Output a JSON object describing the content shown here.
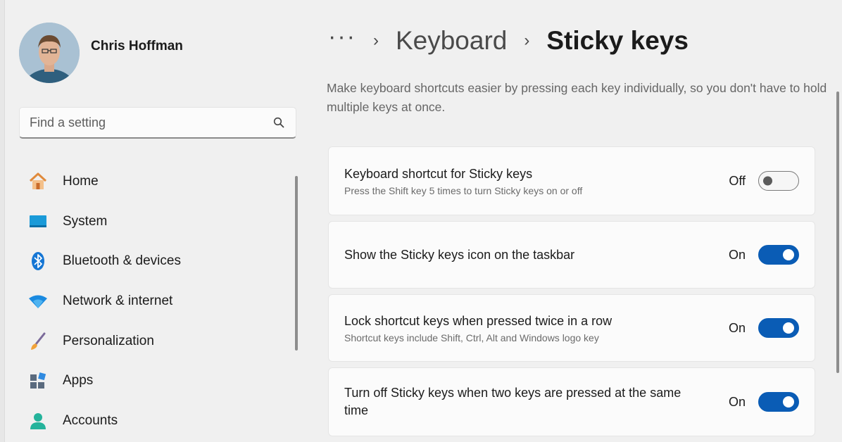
{
  "user": {
    "name": "Chris Hoffman"
  },
  "search": {
    "placeholder": "Find a setting"
  },
  "nav": [
    {
      "label": "Home",
      "icon": "home-icon"
    },
    {
      "label": "System",
      "icon": "system-icon"
    },
    {
      "label": "Bluetooth & devices",
      "icon": "bluetooth-icon"
    },
    {
      "label": "Network & internet",
      "icon": "network-icon"
    },
    {
      "label": "Personalization",
      "icon": "personalization-icon"
    },
    {
      "label": "Apps",
      "icon": "apps-icon"
    },
    {
      "label": "Accounts",
      "icon": "accounts-icon"
    }
  ],
  "breadcrumb": {
    "ellipsis": "···",
    "parent": "Keyboard",
    "separator": "›",
    "current": "Sticky keys"
  },
  "description": "Make keyboard shortcuts easier by pressing each key individually, so you don't have to hold multiple keys at once.",
  "settings": [
    {
      "title": "Keyboard shortcut for Sticky keys",
      "subtitle": "Press the Shift key 5 times to turn Sticky keys on or off",
      "state": "Off",
      "on": false
    },
    {
      "title": "Show the Sticky keys icon on the taskbar",
      "subtitle": "",
      "state": "On",
      "on": true
    },
    {
      "title": "Lock shortcut keys when pressed twice in a row",
      "subtitle": "Shortcut keys include Shift, Ctrl, Alt and Windows logo key",
      "state": "On",
      "on": true
    },
    {
      "title": "Turn off Sticky keys when two keys are pressed at the same time",
      "subtitle": "",
      "state": "On",
      "on": true
    }
  ],
  "colors": {
    "accent": "#0a5cb5",
    "background": "#f0f0f0",
    "card": "#fbfbfb"
  }
}
